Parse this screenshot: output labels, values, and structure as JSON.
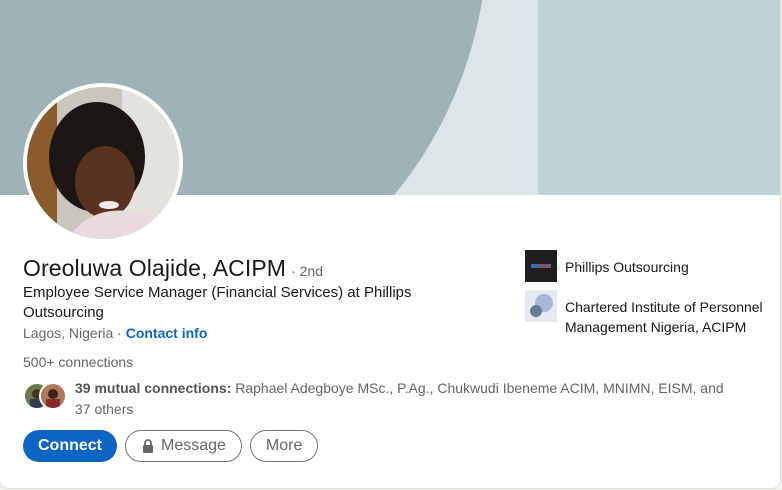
{
  "profile": {
    "name": "Oreoluwa Olajide, ACIPM",
    "degree": "· 2nd",
    "headline": "Employee Service Manager (Financial Services) at Phillips Outsourcing",
    "location": "Lagos, Nigeria ·",
    "contact_info": "Contact info",
    "connections": "500+ connections"
  },
  "mutual": {
    "count_label": "39 mutual connections:",
    "names": " Raphael Adegboye MSc., P.Ag., Chukwudi Ibeneme ACIM, MNIMN, EISM, and 37 others"
  },
  "actions": {
    "connect": "Connect",
    "message": "Message",
    "more": "More"
  },
  "side": {
    "company": "Phillips Outsourcing",
    "education": "Chartered Institute of Personnel Management Nigeria, ACIPM"
  },
  "colors": {
    "accent": "#0a66c2",
    "banner_dark": "#9fb2b6",
    "banner_light": "#dce6e8",
    "banner_panel": "#bfd2d6"
  }
}
